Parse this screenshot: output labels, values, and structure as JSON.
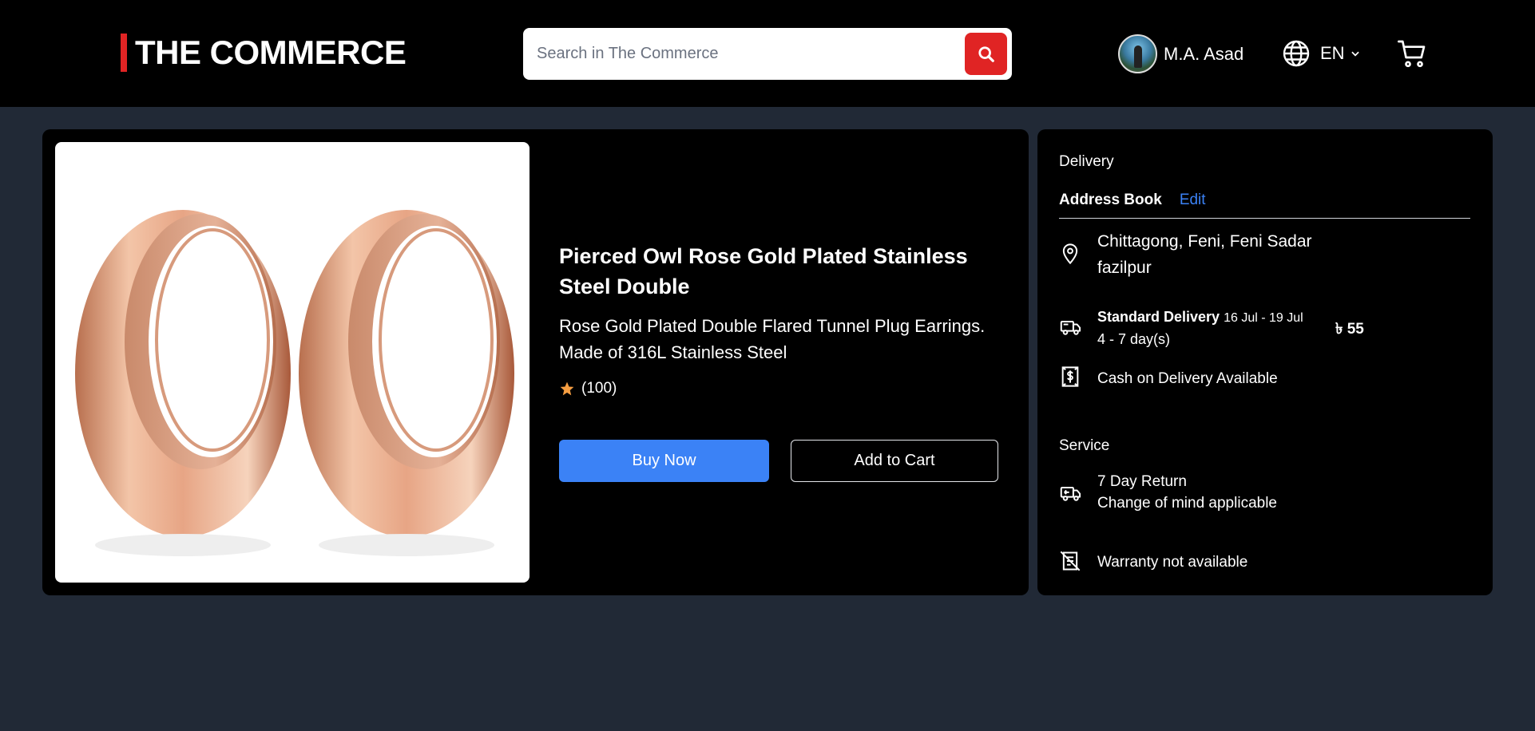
{
  "header": {
    "logo_text": "THE COMMERCE",
    "search_placeholder": "Search in The Commerce",
    "user_name": "M.A. Asad",
    "language": "EN",
    "accent_color": "#e02424"
  },
  "product": {
    "title": "Pierced Owl Rose Gold Plated Stainless Steel Double",
    "description": "Rose Gold Plated Double Flared Tunnel Plug Earrings. Made of 316L Stainless Steel",
    "rating_count": "(100)",
    "buy_now_label": "Buy Now",
    "add_to_cart_label": "Add to Cart",
    "buy_color": "#3b82f6"
  },
  "delivery": {
    "heading": "Delivery",
    "address_book_label": "Address Book",
    "edit_label": "Edit",
    "address_line1": "Chittagong, Feni, Feni Sadar",
    "address_line2": "fazilpur",
    "standard_title": "Standard Delivery",
    "standard_dates": "16 Jul - 19 Jul",
    "standard_days": "4 - 7 day(s)",
    "price": "৳ 55",
    "cod": "Cash on Delivery Available"
  },
  "service": {
    "heading": "Service",
    "return_title": "7 Day Return",
    "return_sub": "Change of mind applicable",
    "warranty": "Warranty not available"
  }
}
